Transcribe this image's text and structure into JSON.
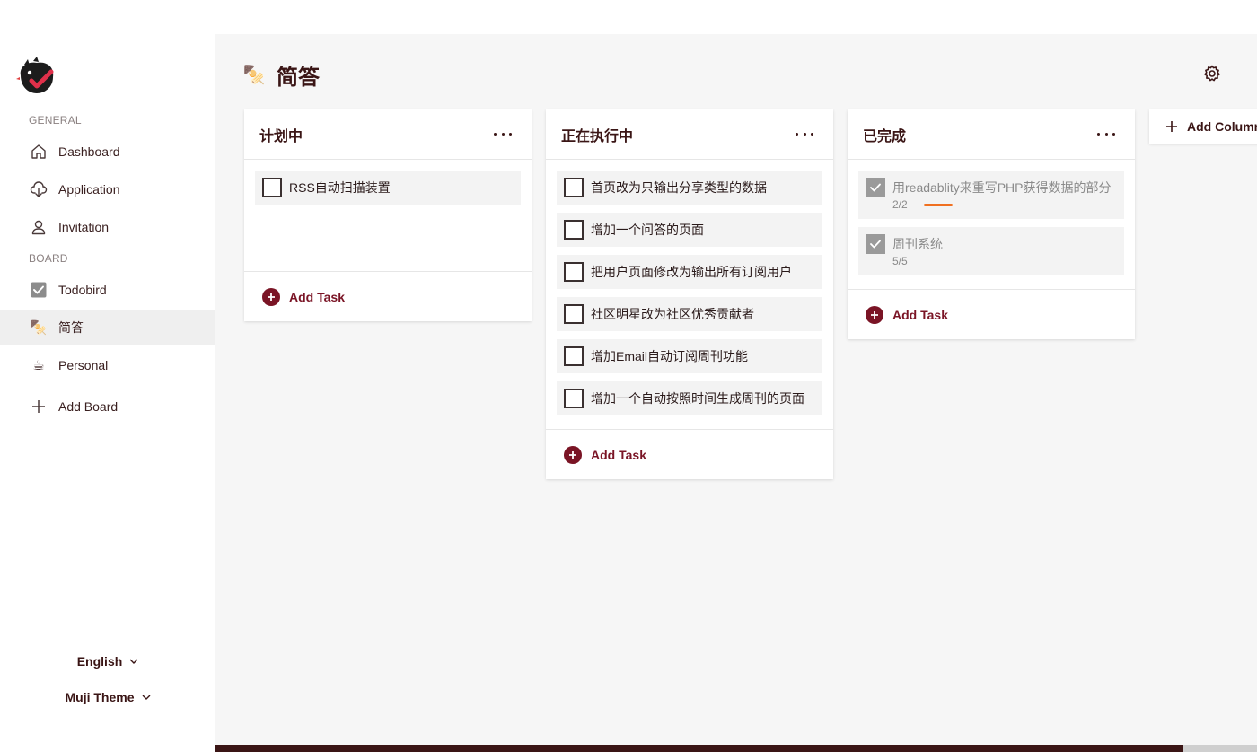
{
  "sidebar": {
    "general_label": "GENERAL",
    "board_label": "BOARD",
    "items": [
      {
        "label": "Dashboard",
        "icon": "home-icon"
      },
      {
        "label": "Application",
        "icon": "cloud-download-icon"
      },
      {
        "label": "Invitation",
        "icon": "user-icon"
      }
    ],
    "boards": [
      {
        "label": "Todobird",
        "icon": "checkbox-icon"
      },
      {
        "label": "简答",
        "icon": "oden-icon",
        "emoji": "🍢",
        "active": true
      },
      {
        "label": "Personal",
        "icon": "coffee-icon",
        "emoji": "☕"
      }
    ],
    "add_board_label": "Add Board",
    "language": "English",
    "theme": "Muji Theme"
  },
  "header": {
    "title": "简答",
    "title_emoji": "🍢"
  },
  "columns": [
    {
      "title": "计划中",
      "tasks": [
        {
          "text": "RSS自动扫描装置",
          "done": false
        }
      ],
      "add_label": "Add Task"
    },
    {
      "title": "正在执行中",
      "tasks": [
        {
          "text": "首页改为只输出分享类型的数据",
          "done": false
        },
        {
          "text": "增加一个问答的页面",
          "done": false
        },
        {
          "text": "把用户页面修改为输出所有订阅用户",
          "done": false
        },
        {
          "text": "社区明星改为社区优秀贡献者",
          "done": false
        },
        {
          "text": "增加Email自动订阅周刊功能",
          "done": false
        },
        {
          "text": "增加一个自动按照时间生成周刊的页面",
          "done": false
        }
      ],
      "add_label": "Add Task"
    },
    {
      "title": "已完成",
      "tasks": [
        {
          "text": "用readablity来重写PHP获得数据的部分",
          "done": true,
          "progress": "2/2",
          "progress_value": 1.0
        },
        {
          "text": "周刊系统",
          "done": true,
          "progress": "5/5"
        }
      ],
      "add_label": "Add Task"
    }
  ],
  "add_column_label": "Add Column",
  "colors": {
    "accent": "#7a1425",
    "text_dark": "#3a1515",
    "progress": "#f07020",
    "main_bg": "#f6f6f6"
  }
}
